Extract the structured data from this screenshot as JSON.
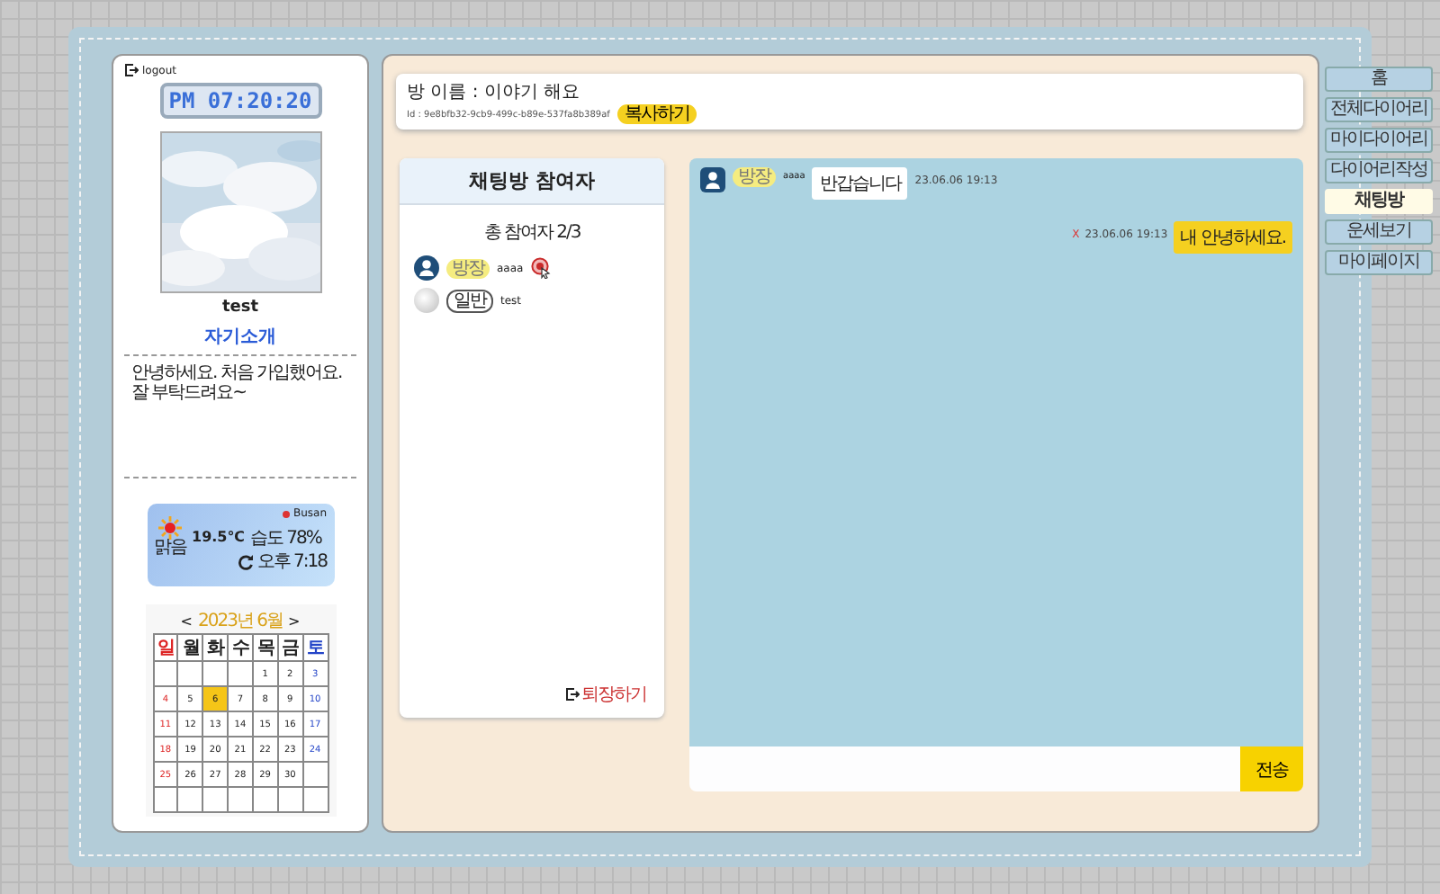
{
  "profile": {
    "logout": "logout",
    "clock": "PM 07:20:20",
    "name": "test",
    "intro_title": "자기소개",
    "intro_lines": [
      "안녕하세요. 처음 가입했어요.",
      "잘 부탁드려요~"
    ]
  },
  "weather": {
    "city": "Busan",
    "temperature": "19.5℃",
    "humidity": "습도 78%",
    "condition": "맑음",
    "updated": "오후 7:18"
  },
  "calendar": {
    "title": "2023년 6월",
    "prev": "<",
    "next": ">",
    "weekdays": [
      "일",
      "월",
      "화",
      "수",
      "목",
      "금",
      "토"
    ],
    "weeks": [
      [
        {
          "kind": "empty"
        },
        {
          "kind": "empty"
        },
        {
          "kind": "empty"
        },
        {
          "kind": "empty"
        },
        {
          "kind": "day",
          "day": "1",
          "selected": false
        },
        {
          "day": "2",
          "selected": false
        },
        {
          "day": "3",
          "selected": false
        }
      ],
      [
        {
          "day": "4",
          "selected": false
        },
        {
          "day": "5",
          "selected": false
        },
        {
          "day": "6",
          "selected": true
        },
        {
          "day": "7",
          "selected": false
        },
        {
          "day": "8",
          "selected": false
        },
        {
          "day": "9",
          "selected": false
        },
        {
          "day": "10",
          "selected": false
        }
      ],
      [
        {
          "day": "11",
          "selected": false
        },
        {
          "day": "12",
          "selected": false
        },
        {
          "day": "13",
          "selected": false
        },
        {
          "day": "14",
          "selected": false
        },
        {
          "day": "15",
          "selected": false
        },
        {
          "day": "16",
          "selected": false
        },
        {
          "day": "17",
          "selected": false
        }
      ],
      [
        {
          "day": "18",
          "selected": false
        },
        {
          "day": "19",
          "selected": false
        },
        {
          "day": "20",
          "selected": false
        },
        {
          "day": "21",
          "selected": false
        },
        {
          "day": "22",
          "selected": false
        },
        {
          "day": "23",
          "selected": false
        },
        {
          "day": "24",
          "selected": false
        }
      ],
      [
        {
          "day": "25",
          "selected": false
        },
        {
          "day": "26",
          "selected": false
        },
        {
          "day": "27",
          "selected": false
        },
        {
          "day": "28",
          "selected": false
        },
        {
          "day": "29",
          "selected": false
        },
        {
          "day": "30",
          "selected": false
        },
        {
          "kind": "empty"
        }
      ],
      [
        {
          "kind": "empty"
        },
        {
          "kind": "empty"
        },
        {
          "kind": "empty"
        },
        {
          "kind": "empty"
        },
        {
          "kind": "empty"
        },
        {
          "kind": "empty"
        },
        {
          "kind": "empty"
        }
      ]
    ]
  },
  "room": {
    "name": "방 이름 : 이야기 해요",
    "id": "Id : 9e8bfb32-9cb9-499c-b89e-537fa8b389af",
    "copy_button": "복사하기"
  },
  "participants": {
    "title": "채팅방 참여자",
    "count": "총 참여자 2/3",
    "items": [
      {
        "kind": "host",
        "role": "방장",
        "name": "aaaa",
        "marker": true
      },
      {
        "kind": "member",
        "role": "일반",
        "name": "test",
        "marker": false
      }
    ],
    "leave": "퇴장하기"
  },
  "messages": [
    {
      "kind": "received",
      "role": "방장",
      "name": "aaaa",
      "text": "반갑습니다",
      "time": "23.06.06 19:13"
    },
    {
      "kind": "sent",
      "delete": "X",
      "text": "내 안녕하세요.",
      "time": "23.06.06 19:13"
    }
  ],
  "composer": {
    "send": "전송"
  },
  "nav": [
    {
      "label": "홈",
      "selected": false
    },
    {
      "label": "전체다이어리",
      "selected": false
    },
    {
      "label": "마이다이어리",
      "selected": false
    },
    {
      "label": "다이어리작성",
      "selected": false
    },
    {
      "label": "채팅방",
      "selected": true
    },
    {
      "label": "운세보기",
      "selected": false
    },
    {
      "label": "마이페이지",
      "selected": false
    }
  ]
}
